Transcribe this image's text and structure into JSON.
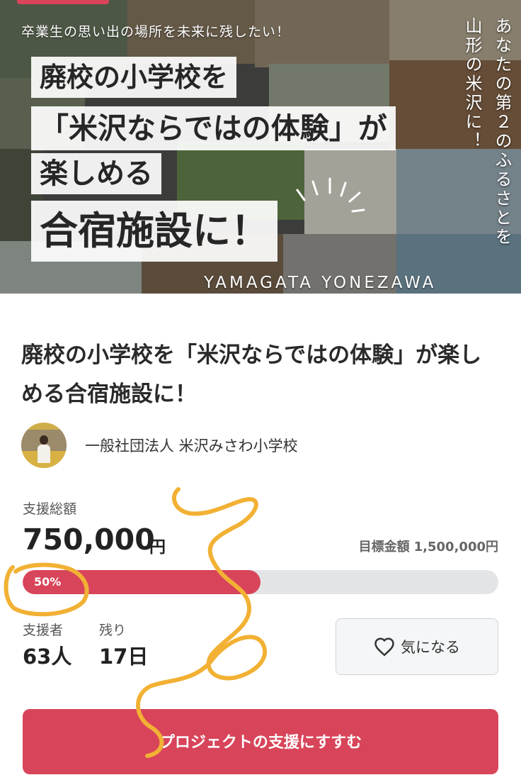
{
  "hero": {
    "tagline": "卒業生の思い出の場所を未来に残したい！",
    "headline_lines": [
      "廃校の小学校を",
      "「米沢ならではの体験」が",
      "楽しめる",
      "合宿施設に！"
    ],
    "vertical_text_right": "あなたの第２のふるさとを",
    "vertical_text_left": "山形の米沢に！",
    "location": "YAMAGATA YONEZAWA",
    "accent_color": "#d8445a"
  },
  "project": {
    "title": "廃校の小学校を「米沢ならではの体験」が楽しめる合宿施設に！",
    "organizer": "一般社団法人 米沢みさわ小学校"
  },
  "funding": {
    "total_label": "支援総額",
    "total_amount": "750,000",
    "currency_unit": "円",
    "goal_label": "目標金額",
    "goal_amount": "1,500,000円",
    "progress_percent": 50,
    "progress_text": "50%",
    "backers_label": "支援者",
    "backers_value": "63人",
    "remaining_label": "残り",
    "remaining_value": "17日"
  },
  "actions": {
    "favorite_label": "気になる",
    "support_label": "プロジェクトの支援にすすむ"
  },
  "colors": {
    "primary": "#d8455a",
    "bar_track": "#e3e4e6",
    "annotation": "#f2b134"
  }
}
